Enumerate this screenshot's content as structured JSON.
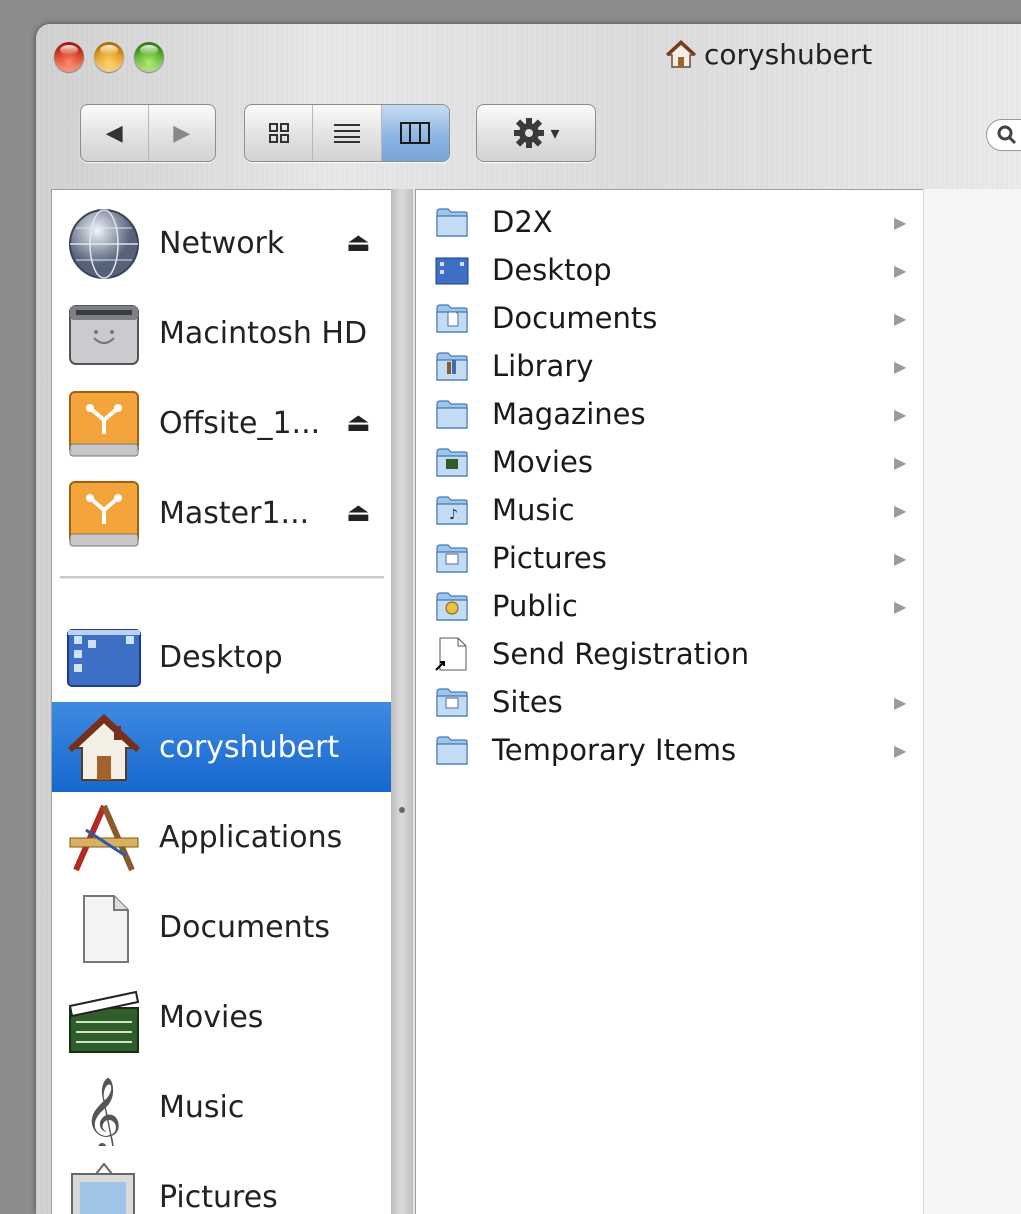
{
  "window": {
    "title": "coryshubert"
  },
  "toolbar": {
    "back_glyph": "◀",
    "forward_glyph": "▶",
    "view_modes": [
      "icon-view",
      "list-view",
      "column-view"
    ],
    "selected_view": "column-view",
    "action_menu_glyph": "▾"
  },
  "sidebar": {
    "devices": [
      {
        "label": "Network",
        "icon": "network-globe-icon",
        "eject": true
      },
      {
        "label": "Macintosh HD",
        "icon": "hard-disk-icon",
        "eject": false
      },
      {
        "label": "Offsite_1...",
        "icon": "firewire-drive-icon",
        "eject": true
      },
      {
        "label": "Master1...",
        "icon": "firewire-drive-icon",
        "eject": true
      }
    ],
    "places": [
      {
        "label": "Desktop",
        "icon": "desktop-icon",
        "selected": false
      },
      {
        "label": "coryshubert",
        "icon": "home-icon",
        "selected": true
      },
      {
        "label": "Applications",
        "icon": "applications-icon",
        "selected": false
      },
      {
        "label": "Documents",
        "icon": "document-icon",
        "selected": false
      },
      {
        "label": "Movies",
        "icon": "clapboard-icon",
        "selected": false
      },
      {
        "label": "Music",
        "icon": "treble-clef-icon",
        "selected": false
      },
      {
        "label": "Pictures",
        "icon": "picture-frame-icon",
        "selected": false
      }
    ],
    "eject_glyph": "⏏"
  },
  "column": {
    "items": [
      {
        "name": "D2X",
        "icon": "folder-icon",
        "has_children": true
      },
      {
        "name": "Desktop",
        "icon": "desktop-folder-icon",
        "has_children": true
      },
      {
        "name": "Documents",
        "icon": "documents-folder-icon",
        "has_children": true
      },
      {
        "name": "Library",
        "icon": "library-folder-icon",
        "has_children": true
      },
      {
        "name": "Magazines",
        "icon": "folder-icon",
        "has_children": true
      },
      {
        "name": "Movies",
        "icon": "movies-folder-icon",
        "has_children": true
      },
      {
        "name": "Music",
        "icon": "music-folder-icon",
        "has_children": true
      },
      {
        "name": "Pictures",
        "icon": "pictures-folder-icon",
        "has_children": true
      },
      {
        "name": "Public",
        "icon": "public-folder-icon",
        "has_children": true
      },
      {
        "name": "Send Registration",
        "icon": "alias-document-icon",
        "has_children": false
      },
      {
        "name": "Sites",
        "icon": "sites-folder-icon",
        "has_children": true
      },
      {
        "name": "Temporary Items",
        "icon": "folder-icon",
        "has_children": true
      }
    ],
    "arrow_glyph": "▶"
  },
  "colors": {
    "selection": "#1f6fd4",
    "folder_blue": "#7fb2e6"
  }
}
